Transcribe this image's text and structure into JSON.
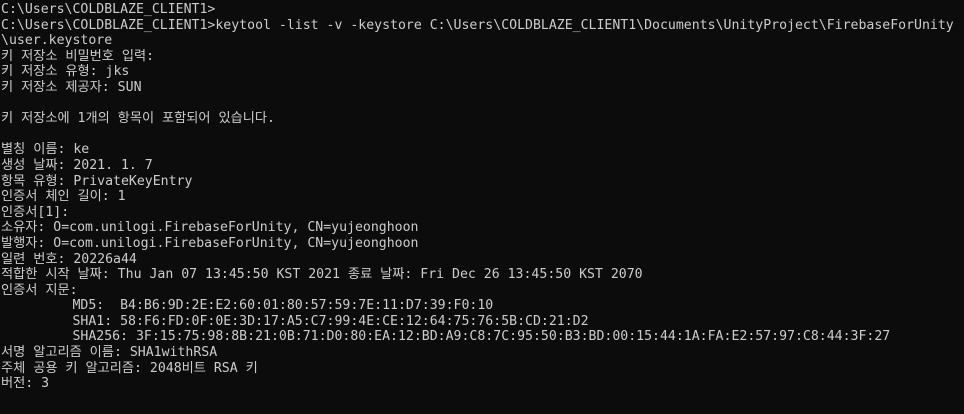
{
  "console": {
    "background": "#0c0c0c",
    "foreground": "#cccccc",
    "lines": [
      "C:\\Users\\COLDBLAZE_CLIENT1>",
      "C:\\Users\\COLDBLAZE_CLIENT1>keytool -list -v -keystore C:\\Users\\COLDBLAZE_CLIENT1\\Documents\\UnityProject\\FirebaseForUnity",
      "\\user.keystore",
      "키 저장소 비밀번호 입력:",
      "키 저장소 유형: jks",
      "키 저장소 제공자: SUN",
      "",
      "키 저장소에 1개의 항목이 포함되어 있습니다.",
      "",
      "별칭 이름: ke",
      "생성 날짜: 2021. 1. 7",
      "항목 유형: PrivateKeyEntry",
      "인증서 체인 길이: 1",
      "인증서[1]:",
      "소유자: O=com.unilogi.FirebaseForUnity, CN=yujeonghoon",
      "발행자: O=com.unilogi.FirebaseForUnity, CN=yujeonghoon",
      "일련 번호: 20226a44",
      "적합한 시작 날짜: Thu Jan 07 13:45:50 KST 2021 종료 날짜: Fri Dec 26 13:45:50 KST 2070",
      "인증서 지문:",
      "         MD5:  B4:B6:9D:2E:E2:60:01:80:57:59:7E:11:D7:39:F0:10",
      "         SHA1: 58:F6:FD:0F:0E:3D:17:A5:C7:99:4E:CE:12:64:75:76:5B:CD:21:D2",
      "         SHA256: 3F:15:75:98:8B:21:0B:71:D0:80:EA:12:BD:A9:C8:7C:95:50:B3:BD:00:15:44:1A:FA:E2:57:97:C8:44:3F:27",
      "서명 알고리즘 이름: SHA1withRSA",
      "주체 공용 키 알고리즘: 2048비트 RSA 키",
      "버전: 3"
    ]
  }
}
